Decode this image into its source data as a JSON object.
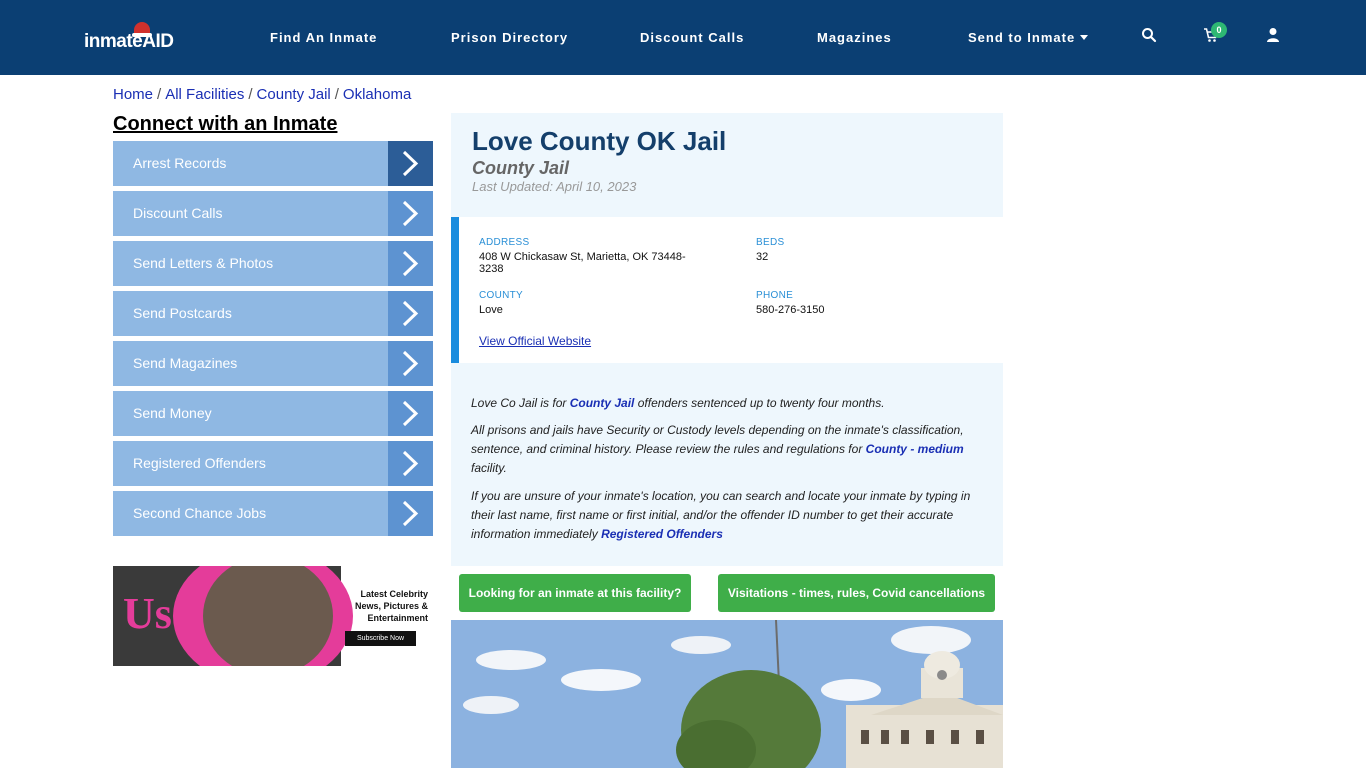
{
  "header": {
    "logo_text": "inmateAID",
    "nav": {
      "find_inmate": "Find An Inmate",
      "prison_directory": "Prison Directory",
      "discount_calls": "Discount Calls",
      "magazines": "Magazines",
      "send_to_inmate": "Send to Inmate"
    },
    "cart_count": "0"
  },
  "breadcrumb": {
    "home": "Home",
    "all_facilities": "All Facilities",
    "county_jail": "County Jail",
    "state": "Oklahoma",
    "separator": "/"
  },
  "sidebar": {
    "title": "Connect with an Inmate",
    "items": [
      {
        "label": "Arrest Records"
      },
      {
        "label": "Discount Calls"
      },
      {
        "label": "Send Letters & Photos"
      },
      {
        "label": "Send Postcards"
      },
      {
        "label": "Send Magazines"
      },
      {
        "label": "Send Money"
      },
      {
        "label": "Registered Offenders"
      },
      {
        "label": "Second Chance Jobs"
      }
    ]
  },
  "ad": {
    "brand": "Us",
    "text": "Latest Celebrity News, Pictures & Entertainment",
    "button": "Subscribe Now"
  },
  "facility": {
    "title": "Love County OK Jail",
    "type": "County Jail",
    "last_updated": "Last Updated: April 10, 2023",
    "address_label": "ADDRESS",
    "address": "408 W Chickasaw St, Marietta, OK 73448-3238",
    "beds_label": "BEDS",
    "beds": "32",
    "county_label": "COUNTY",
    "county": "Love",
    "phone_label": "PHONE",
    "phone": "580-276-3150",
    "website_link": "View Official Website"
  },
  "description": {
    "p1_pre": "Love Co Jail is for ",
    "p1_link": "County Jail",
    "p1_post": " offenders sentenced up to twenty four months.",
    "p2_pre": "All prisons and jails have Security or Custody levels depending on the inmate's classification, sentence, and criminal history. Please review the rules and regulations for ",
    "p2_link": "County - medium",
    "p2_post": " facility.",
    "p3_pre": "If you are unsure of your inmate's location, you can search and locate your inmate by typing in their last name, first name or first initial, and/or the offender ID number to get their accurate information immediately ",
    "p3_link": "Registered Offenders"
  },
  "buttons": {
    "looking": "Looking for an inmate at this facility?",
    "visitations": "Visitations - times, rules, Covid cancellations"
  },
  "colors": {
    "header_bg": "#0b3f73",
    "sidebar_item": "#8fb8e3",
    "sidebar_arrow": "#5d93d1",
    "green": "#3fae49",
    "link": "#1a2fb4"
  }
}
